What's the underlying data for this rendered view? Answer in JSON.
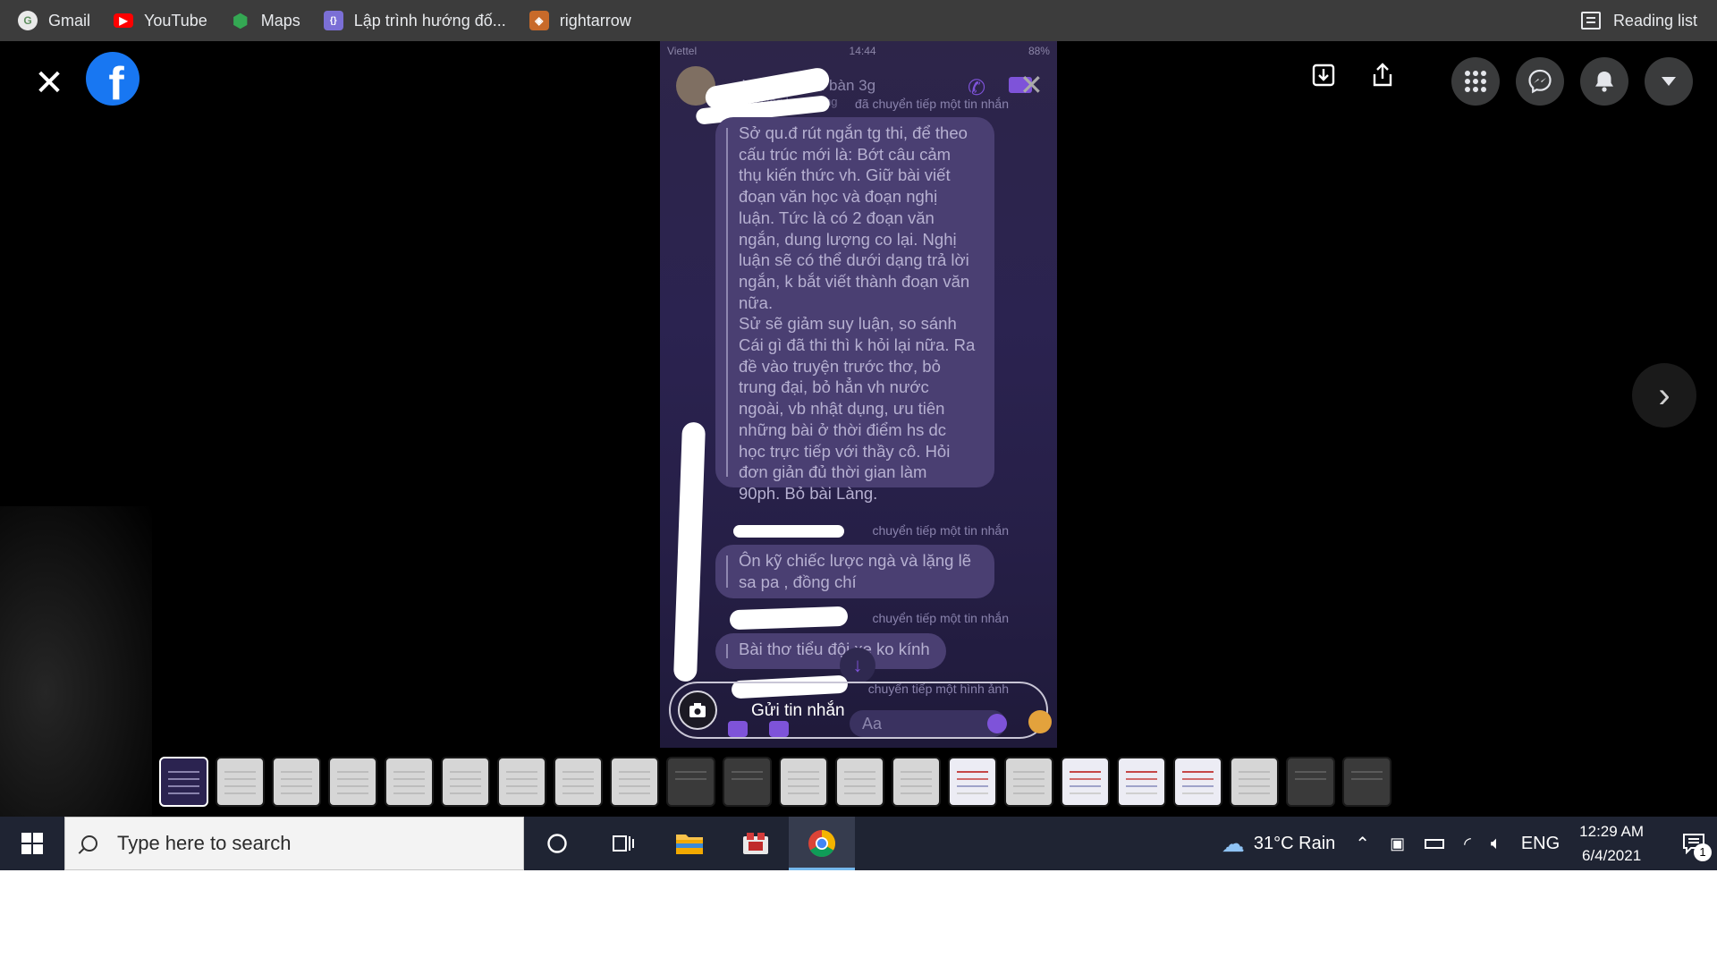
{
  "bookmarks": {
    "items": [
      {
        "label": "Gmail",
        "icon": "gmail-icon"
      },
      {
        "label": "YouTube",
        "icon": "youtube-icon"
      },
      {
        "label": "Maps",
        "icon": "maps-icon"
      },
      {
        "label": "Lập trình hướng đố...",
        "icon": "code-icon"
      },
      {
        "label": "rightarrow",
        "icon": "game-icon"
      }
    ],
    "reading_list": "Reading list"
  },
  "viewer": {
    "close_icon": "close-icon",
    "logo": "facebook-logo",
    "logo_text": "f"
  },
  "photo": {
    "status_bar": {
      "carrier": "Viettel",
      "time": "14:44",
      "battery": "88%"
    },
    "contact_name": "ddcbong đến bàn",
    "contact_suffix": "3g",
    "contact_status": "Đang hoạt động",
    "forward_1": "đã chuyển tiếp một tin nhắn",
    "message_1_lines": [
      "Sở qu.đ rút ngắn tg thi, để theo",
      "cấu trúc mới là: Bớt câu cảm",
      "thụ kiến thức vh. Giữ bài viết",
      "đoạn văn học và đoạn nghị",
      "luận. Tức là có 2 đoạn văn",
      "ngắn, dung lượng co lại. Nghị",
      "luận sẽ có thể dưới dạng trả lời",
      "ngắn, k bắt viết thành đoạn văn",
      "nữa.",
      "Sử sẽ giảm suy luận, so sánh",
      "Cái gì đã thi thì k hỏi lại nữa. Ra",
      "đề vào truyện trước thơ, bỏ",
      "trung đại, bỏ hẳn vh nước",
      "ngoài, vb nhật dụng, ưu tiên",
      "những bài ở thời điểm hs dc",
      "học trực tiếp với thầy cô. Hỏi",
      "đơn giản đủ thời gian làm",
      "90ph. Bỏ bài Làng."
    ],
    "forward_2": "chuyển tiếp một tin nhắn",
    "message_2_lines": [
      "Ôn kỹ chiếc lược ngà và lặng lẽ",
      "sa pa , đồng chí"
    ],
    "forward_3": "chuyển tiếp một tin nhắn",
    "message_3": "Bài thơ tiểu đội xe ko kính",
    "forward_4": "chuyển tiếp một hình ảnh",
    "send_label": "Gửi tin nhắn",
    "input_placeholder": "Aa"
  },
  "thumbnails": {
    "count": 22,
    "active_index": 0
  },
  "taskbar": {
    "search_placeholder": "Type here to search",
    "weather": "31°C  Rain",
    "language": "ENG",
    "time": "12:29 AM",
    "date": "6/4/2021",
    "notification_count": "1"
  },
  "colors": {
    "facebook_blue": "#1877f2",
    "messenger_purple": "#7e53d9",
    "chrome_active_underline": "#76b9ed"
  }
}
